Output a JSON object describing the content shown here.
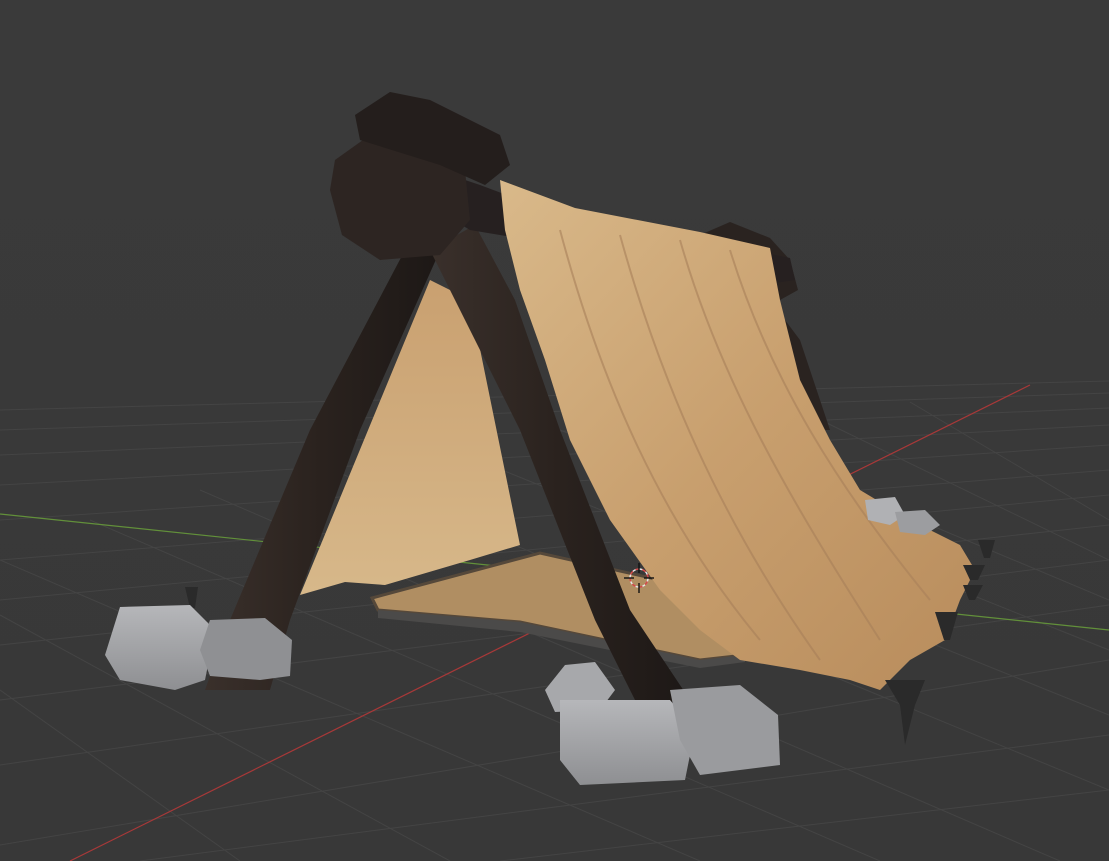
{
  "viewport": {
    "background_color": "#393939",
    "grid_color": "#444444",
    "x_axis_color": "#b33a3a",
    "y_axis_color": "#6f9e3a"
  },
  "scene_object": {
    "name": "tent",
    "wood_color": "#2b2320",
    "wood_dark_color": "#1c1715",
    "cloth_color": "#c9a477",
    "cloth_light_color": "#d8b98c",
    "stone_color": "#9c9da0",
    "stone_light_color": "#b4b5b8",
    "floor_color": "#b08e62",
    "stake_color": "#2a2a2a"
  },
  "cursor_icon": "3d-cursor-icon"
}
